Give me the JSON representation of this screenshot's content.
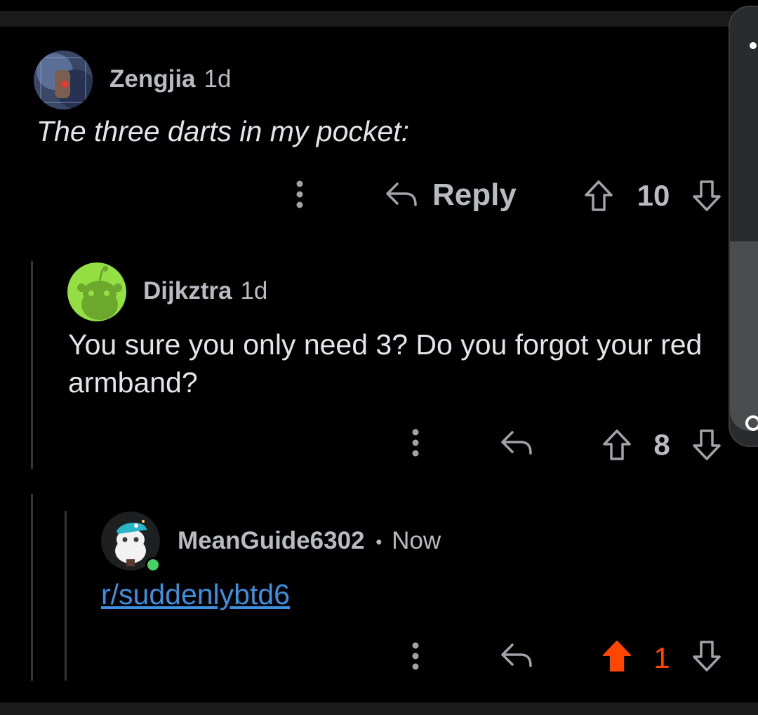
{
  "comments": [
    {
      "username": "Zengjia",
      "age": "1d",
      "body": "The three darts in my pocket:",
      "reply_label": "Reply",
      "score": "10"
    },
    {
      "username": "Dijkztra",
      "age": "1d",
      "body": "You sure you only need 3? Do you forgot your red armband?",
      "score": "8"
    },
    {
      "username": "MeanGuide6302",
      "separator": "•",
      "age": "Now",
      "link": "r/suddenlybtd6",
      "score": "1"
    }
  ],
  "colors": {
    "background": "#000000",
    "upvote_active": "#ff4500",
    "link": "#3d8fe0",
    "online": "#46d160"
  },
  "icons": {
    "more": "more-vertical-icon",
    "reply": "reply-arrow-icon",
    "upvote": "upvote-arrow-icon",
    "downvote": "downvote-arrow-icon"
  }
}
